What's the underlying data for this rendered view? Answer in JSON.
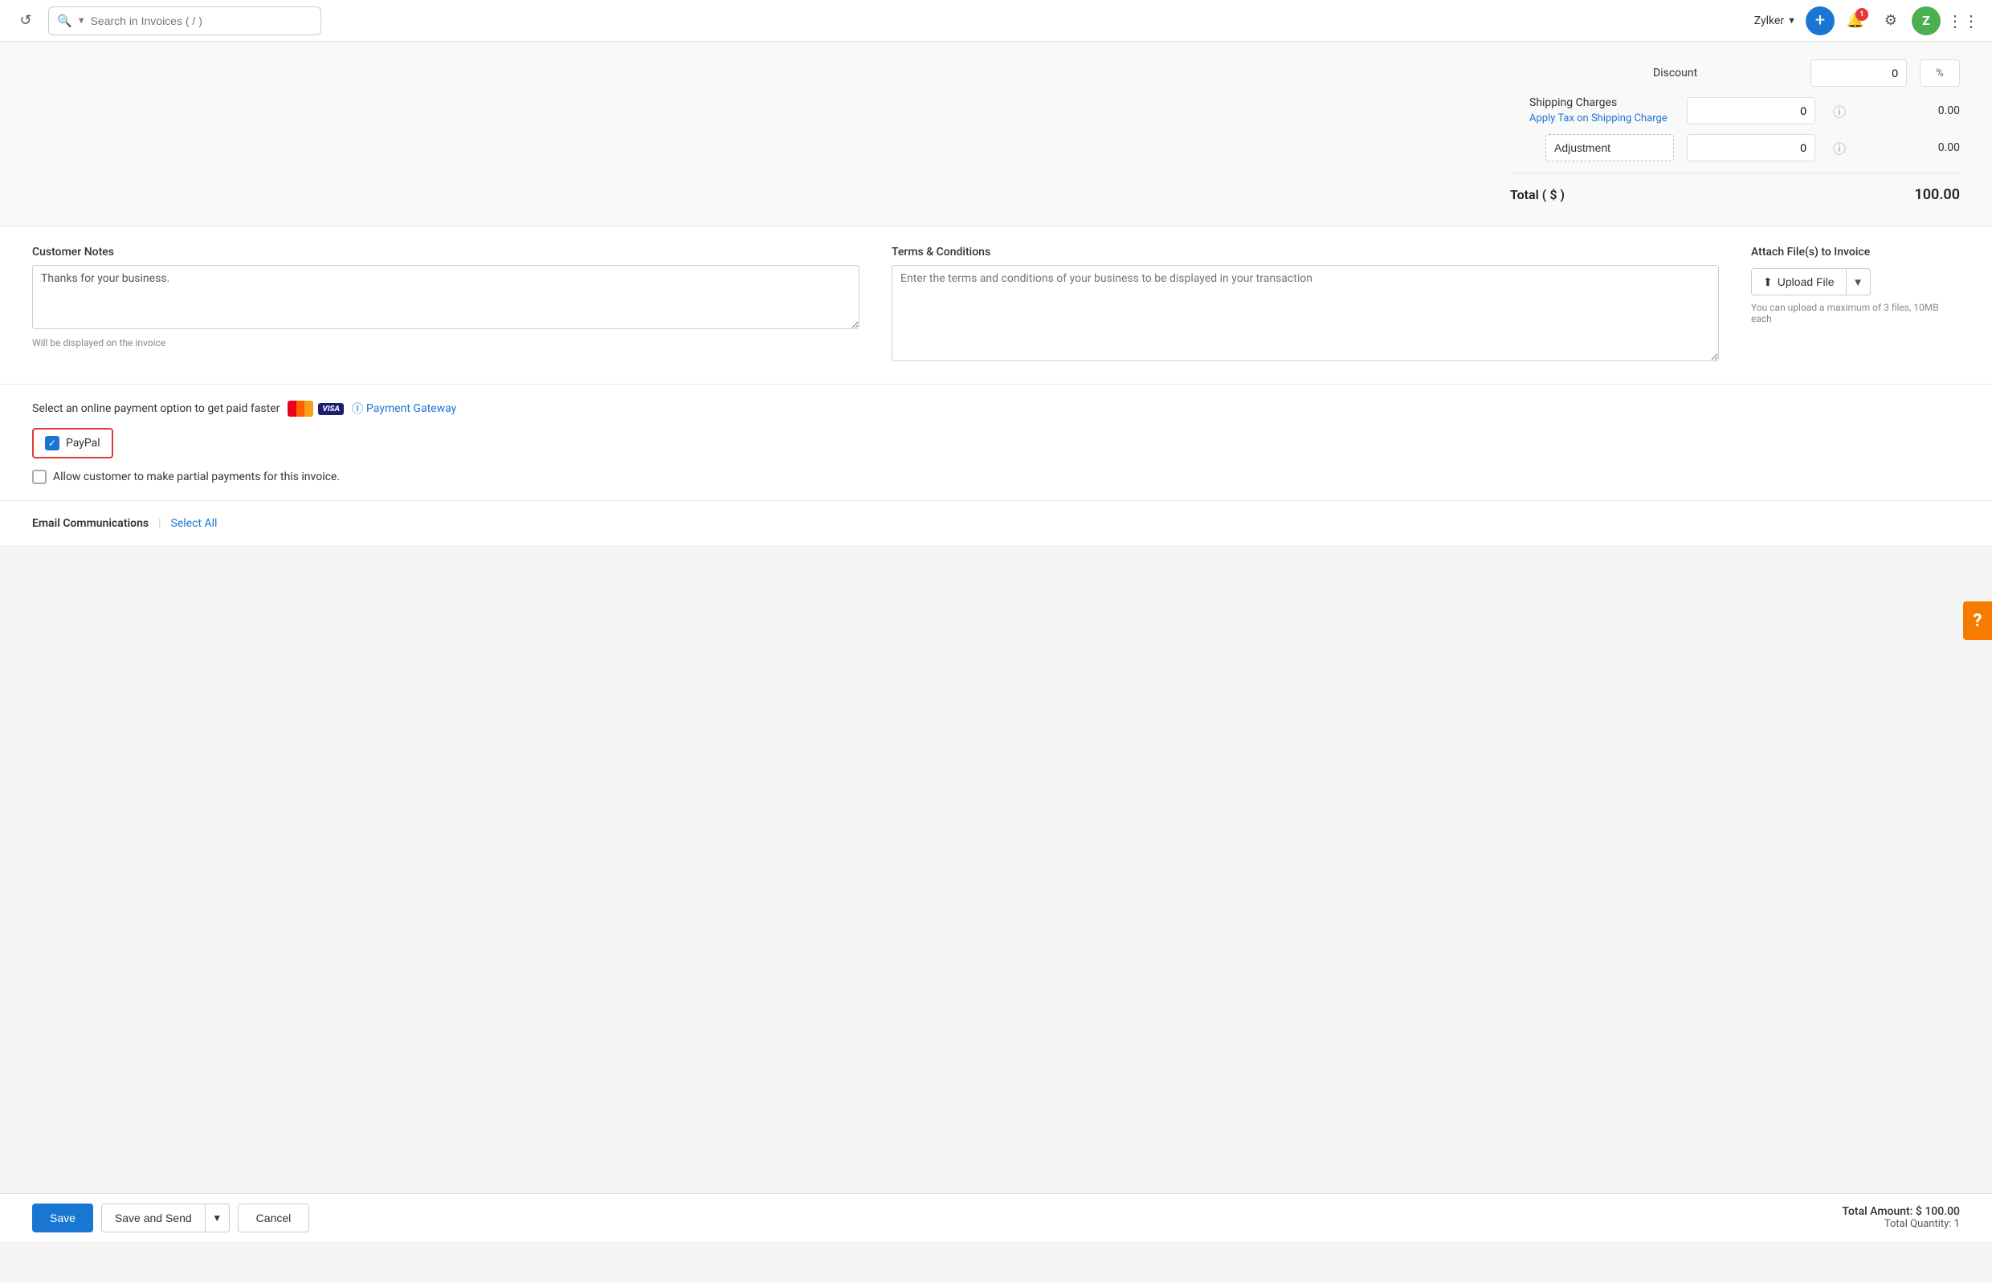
{
  "nav": {
    "search_placeholder": "Search in Invoices ( / )",
    "org_name": "Zylker",
    "notification_count": "1",
    "avatar_letter": "Z",
    "add_icon": "+",
    "grid_icon": "⋮⋮⋮"
  },
  "totals": {
    "discount_label": "Discount",
    "discount_value": "0",
    "discount_percent": "%",
    "discount_amount": "",
    "shipping_label": "Shipping Charges",
    "shipping_value": "0",
    "shipping_amount": "0.00",
    "apply_tax_label": "Apply Tax on Shipping Charge",
    "adjustment_label": "Adjustment",
    "adjustment_value": "0",
    "adjustment_amount": "0.00",
    "total_label": "Total ( $ )",
    "total_value": "100.00",
    "help_icon": "?"
  },
  "customer_notes": {
    "label": "Customer Notes",
    "value": "Thanks for your business.",
    "hint": "Will be displayed on the invoice"
  },
  "terms": {
    "label": "Terms & Conditions",
    "placeholder": "Enter the terms and conditions of your business to be displayed in your transaction"
  },
  "attach": {
    "label": "Attach File(s) to Invoice",
    "upload_btn": "Upload File",
    "hint": "You can upload a maximum of 3 files, 10MB each"
  },
  "payment": {
    "title": "Select an online payment option to get paid faster",
    "gateway_label": "Payment Gateway",
    "paypal_label": "PayPal",
    "paypal_checked": true,
    "partial_label": "Allow customer to make partial payments for this invoice.",
    "partial_checked": false
  },
  "email": {
    "label": "Email Communications",
    "select_all": "Select All"
  },
  "actions": {
    "save": "Save",
    "save_and_send": "Save and Send",
    "cancel": "Cancel",
    "total_amount_label": "Total Amount: $ 100.00",
    "total_qty_label": "Total Quantity: 1"
  },
  "help": {
    "label": "?"
  }
}
